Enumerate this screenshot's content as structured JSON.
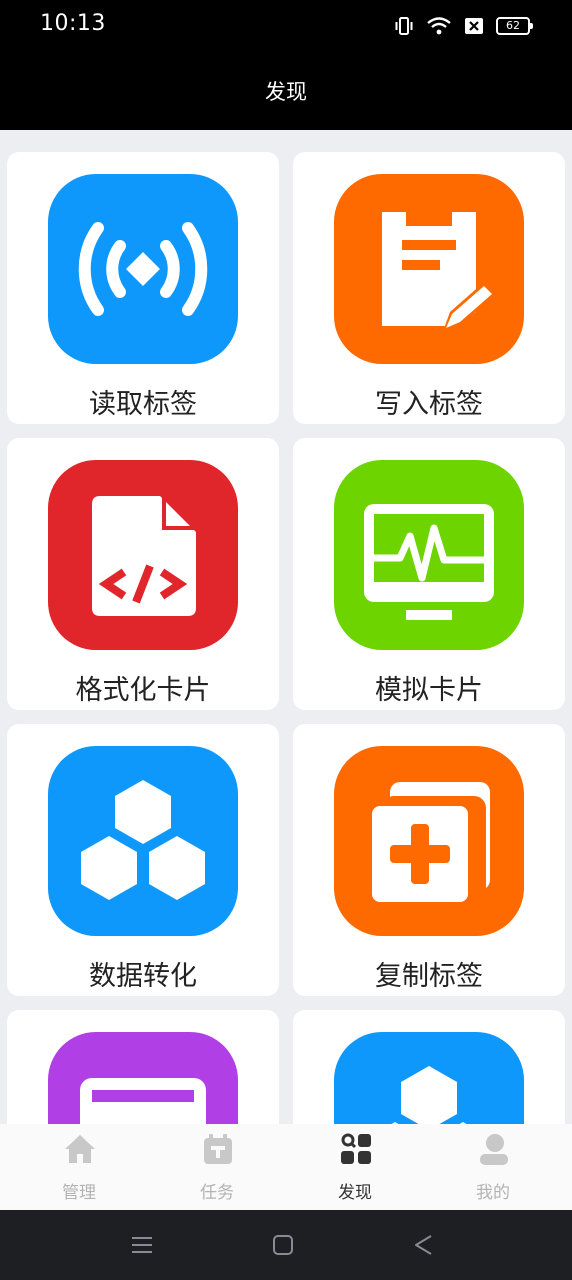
{
  "status_bar": {
    "time": "10:13",
    "battery": "62",
    "icons": [
      "vibrate-icon",
      "wifi-icon",
      "no-sim-icon",
      "battery-icon"
    ]
  },
  "header": {
    "title": "发现"
  },
  "colors": {
    "blue": "#0f98fc",
    "orange": "#ff6a00",
    "red": "#e0252b",
    "green": "#6ed400",
    "purple": "#b13fe6"
  },
  "features": [
    {
      "label": "读取标签",
      "icon": "nfc-read-icon",
      "color": "#0f98fc"
    },
    {
      "label": "写入标签",
      "icon": "notepad-write-icon",
      "color": "#ff6a00"
    },
    {
      "label": "格式化卡片",
      "icon": "code-file-icon",
      "color": "#e0252b"
    },
    {
      "label": "模拟卡片",
      "icon": "monitor-pulse-icon",
      "color": "#6ed400"
    },
    {
      "label": "数据转化",
      "icon": "hexagons-icon",
      "color": "#0f98fc"
    },
    {
      "label": "复制标签",
      "icon": "copy-add-icon",
      "color": "#ff6a00"
    },
    {
      "label": "",
      "icon": "card-icon",
      "color": "#b13fe6"
    },
    {
      "label": "",
      "icon": "hexagon-icon",
      "color": "#0f98fc"
    }
  ],
  "tabs": [
    {
      "label": "管理",
      "icon": "home-icon",
      "active": false
    },
    {
      "label": "任务",
      "icon": "task-icon",
      "active": false
    },
    {
      "label": "发现",
      "icon": "discover-icon",
      "active": true
    },
    {
      "label": "我的",
      "icon": "profile-icon",
      "active": false
    }
  ],
  "system_nav": [
    "menu-icon",
    "home-square-icon",
    "back-icon"
  ]
}
